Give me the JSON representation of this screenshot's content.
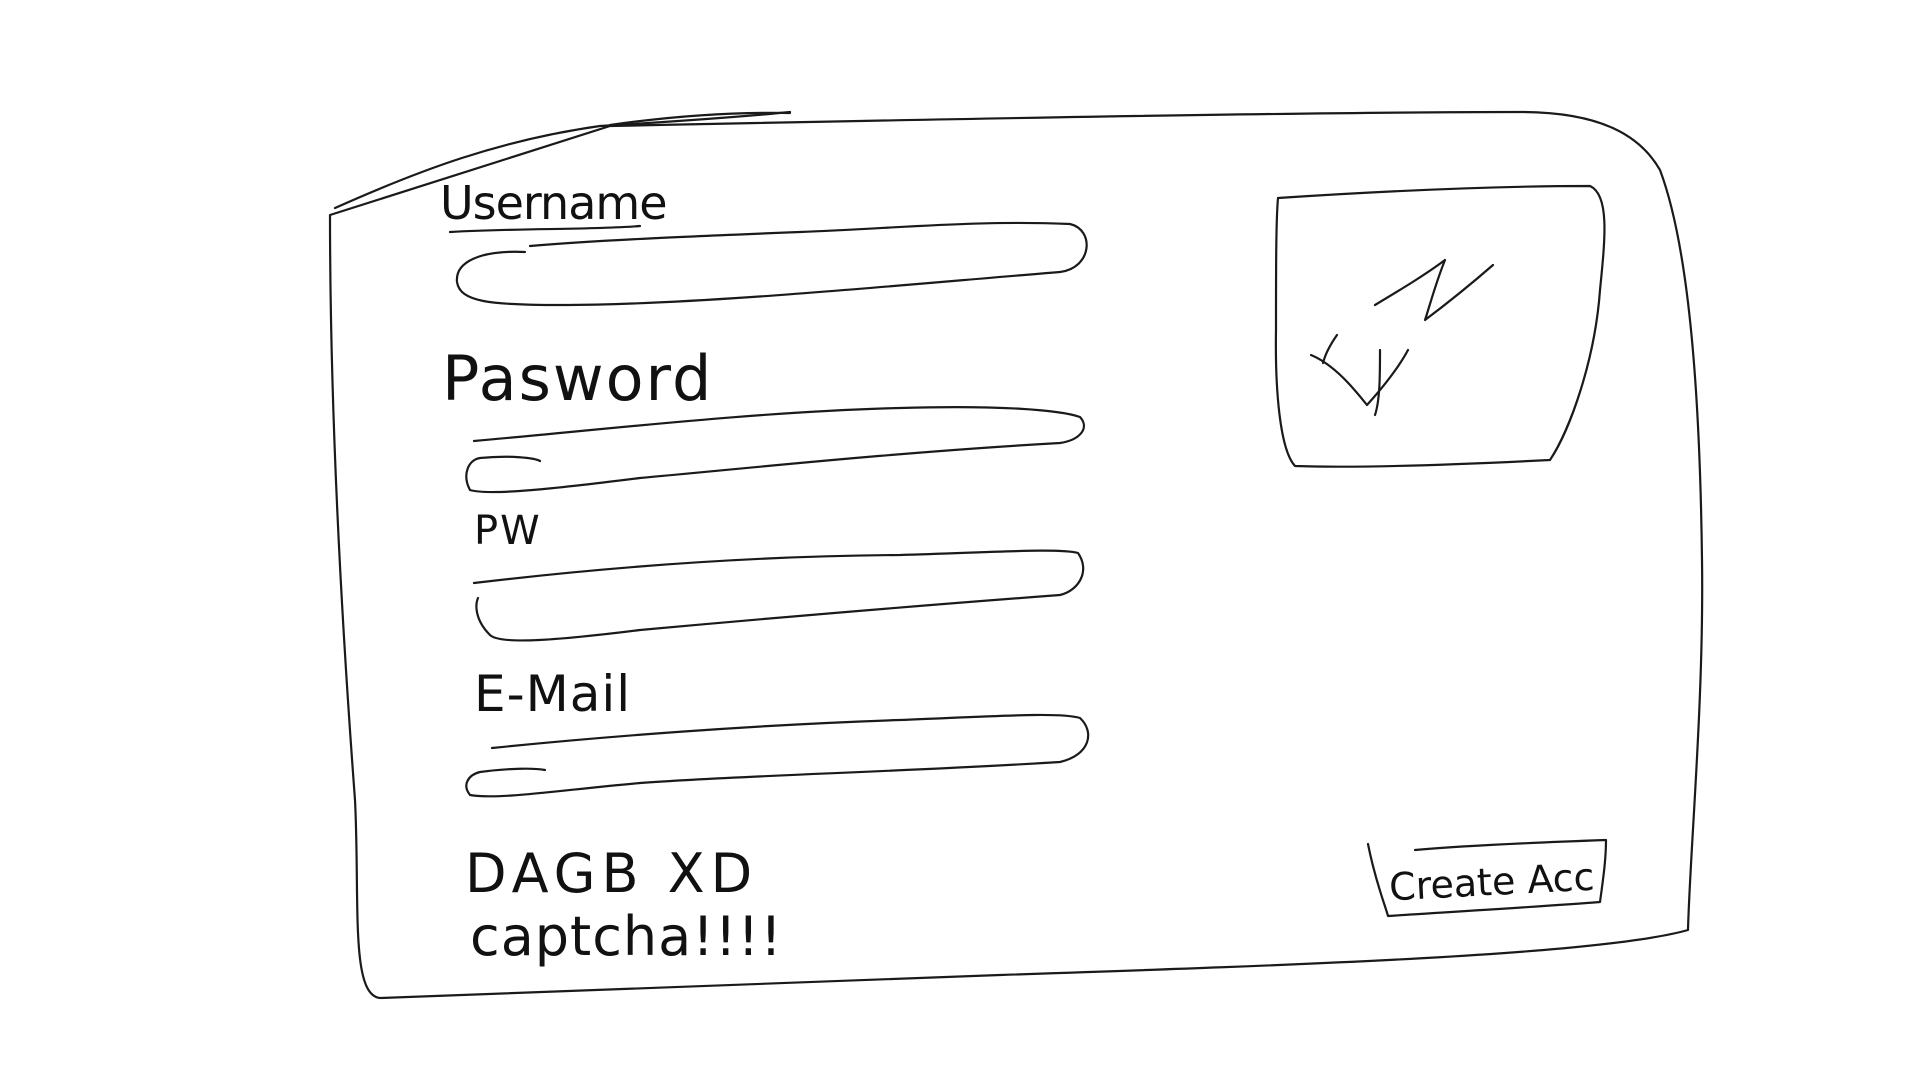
{
  "form": {
    "username_label": "Username",
    "password_label": "Pasword",
    "pw_label": "PW",
    "email_label": "E-Mail",
    "username_value": "",
    "password_value": "",
    "pw_value": "",
    "email_value": ""
  },
  "captcha": {
    "code": "DAGB XD",
    "caption": "captcha!!!!"
  },
  "image_placeholder": {
    "icon": "image-placeholder-icon"
  },
  "actions": {
    "create_label": "Create Acc"
  }
}
